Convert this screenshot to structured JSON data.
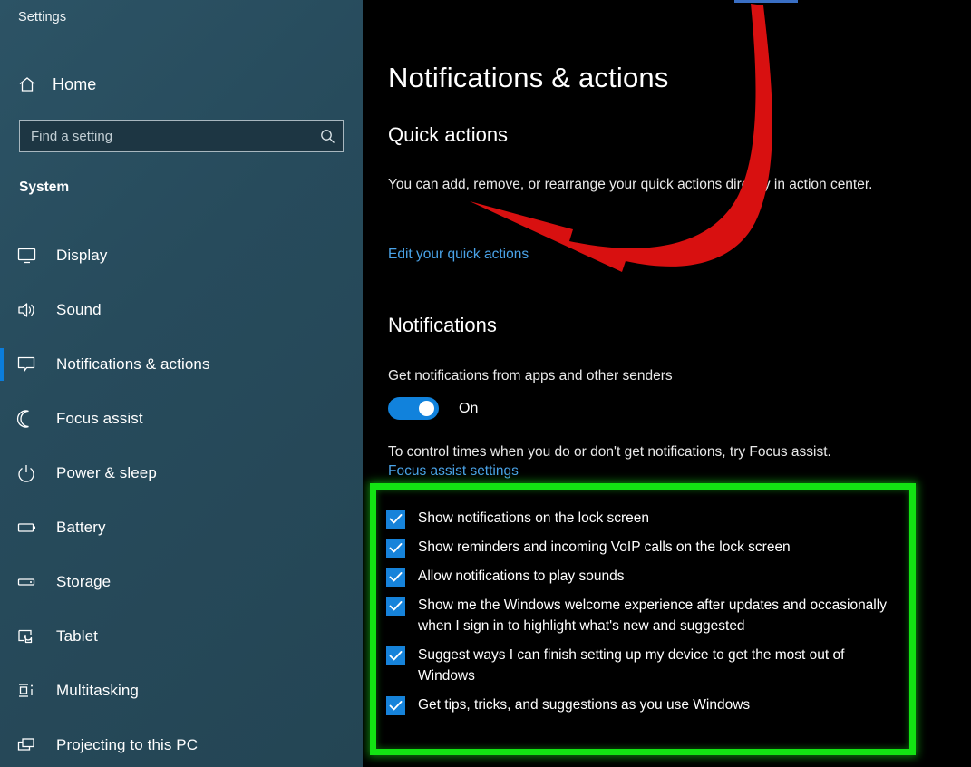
{
  "window": {
    "title": "Settings"
  },
  "sidebar": {
    "home_label": "Home",
    "home_icon": "home-icon",
    "search": {
      "placeholder": "Find a setting",
      "value": "",
      "icon": "search-icon"
    },
    "group_header": "System",
    "items": [
      {
        "label": "Display",
        "icon": "monitor-icon",
        "selected": false
      },
      {
        "label": "Sound",
        "icon": "speaker-icon",
        "selected": false
      },
      {
        "label": "Notifications & actions",
        "icon": "chat-bubble-icon",
        "selected": true
      },
      {
        "label": "Focus assist",
        "icon": "moon-icon",
        "selected": false
      },
      {
        "label": "Power & sleep",
        "icon": "power-icon",
        "selected": false
      },
      {
        "label": "Battery",
        "icon": "battery-icon",
        "selected": false
      },
      {
        "label": "Storage",
        "icon": "drive-icon",
        "selected": false
      },
      {
        "label": "Tablet",
        "icon": "tablet-touch-icon",
        "selected": false
      },
      {
        "label": "Multitasking",
        "icon": "multitasking-icon",
        "selected": false
      },
      {
        "label": "Projecting to this PC",
        "icon": "projecting-icon",
        "selected": false
      }
    ]
  },
  "main": {
    "page_title": "Notifications & actions",
    "quick_actions": {
      "heading": "Quick actions",
      "description": "You can add, remove, or rearrange your quick actions directly in action center.",
      "link": "Edit your quick actions"
    },
    "notifications": {
      "heading": "Notifications",
      "description": "Get notifications from apps and other senders",
      "toggle_state": "On",
      "toggle_on": true,
      "focus_description": "To control times when you do or don't get notifications, try Focus assist.",
      "focus_link": "Focus assist settings",
      "checkboxes": [
        {
          "label": "Show notifications on the lock screen",
          "checked": true
        },
        {
          "label": "Show reminders and incoming VoIP calls on the lock screen",
          "checked": true
        },
        {
          "label": "Allow notifications to play sounds",
          "checked": true
        },
        {
          "label": "Show me the Windows welcome experience after updates and occasionally when I sign in to highlight what's new and suggested",
          "checked": true
        },
        {
          "label": "Suggest ways I can finish setting up my device to get the most out of Windows",
          "checked": true
        },
        {
          "label": "Get tips, tricks, and suggestions as you use Windows",
          "checked": true
        }
      ]
    }
  },
  "annotations": {
    "arrow_color": "#d81010",
    "highlight_color": "#13e313",
    "arrow_target": "notifications-toggle",
    "highlight_target": "notification-checkbox-list"
  },
  "colors": {
    "sidebar_bg": "#2a4f60",
    "content_bg": "#000000",
    "accent_blue": "#0b7ddb",
    "link_blue": "#4aa3e8",
    "toggle_on": "#1182dc",
    "checkbox_blue": "#1683da"
  }
}
